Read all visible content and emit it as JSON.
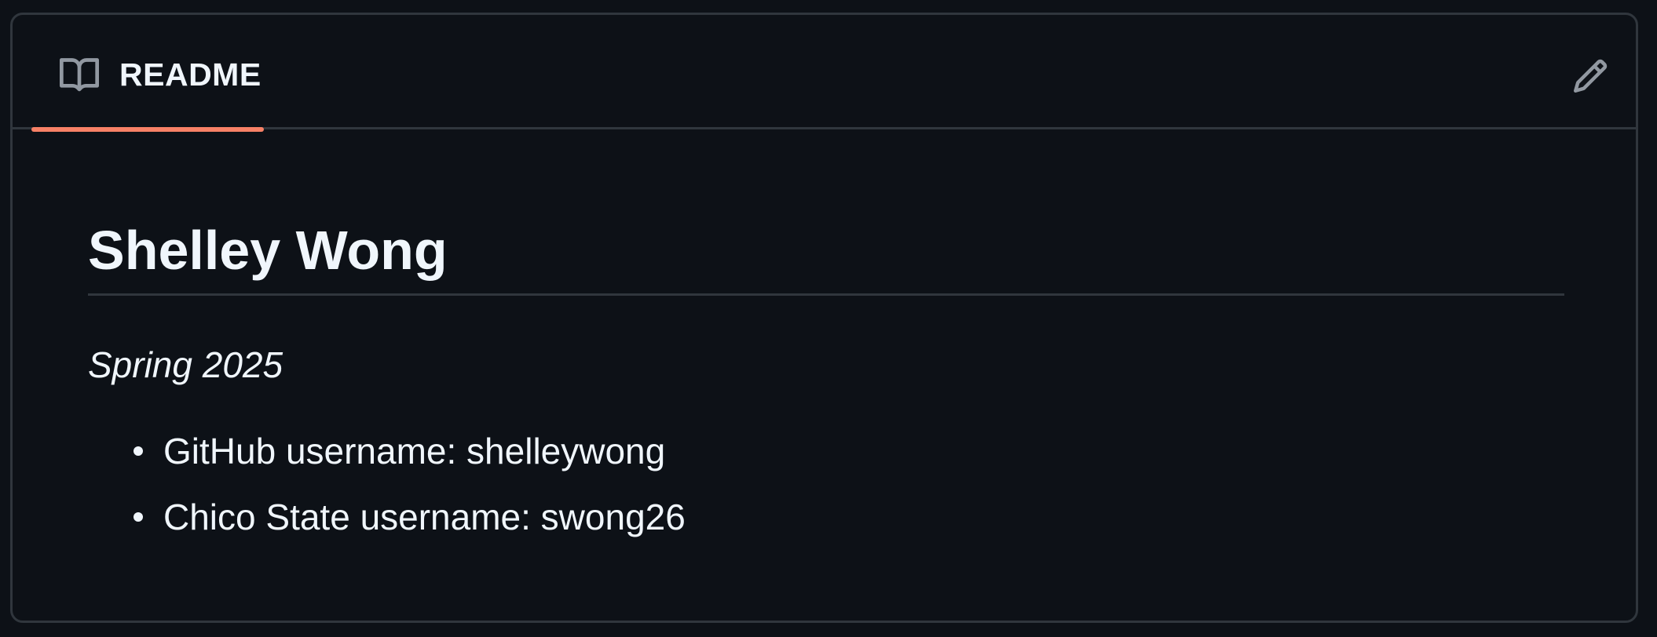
{
  "readme_tab": {
    "label": "README",
    "icon": "book-icon",
    "accent_color": "#f78166"
  },
  "edit_icon": "pencil-icon",
  "content": {
    "title": "Shelley Wong",
    "subtitle": "Spring 2025",
    "items": [
      {
        "label": "GitHub username: shelleywong"
      },
      {
        "label": "Chico State username: swong26"
      }
    ]
  },
  "colors": {
    "background": "#0d1117",
    "border": "#30363d",
    "text": "#f0f6fc",
    "icon": "#9198a1"
  }
}
